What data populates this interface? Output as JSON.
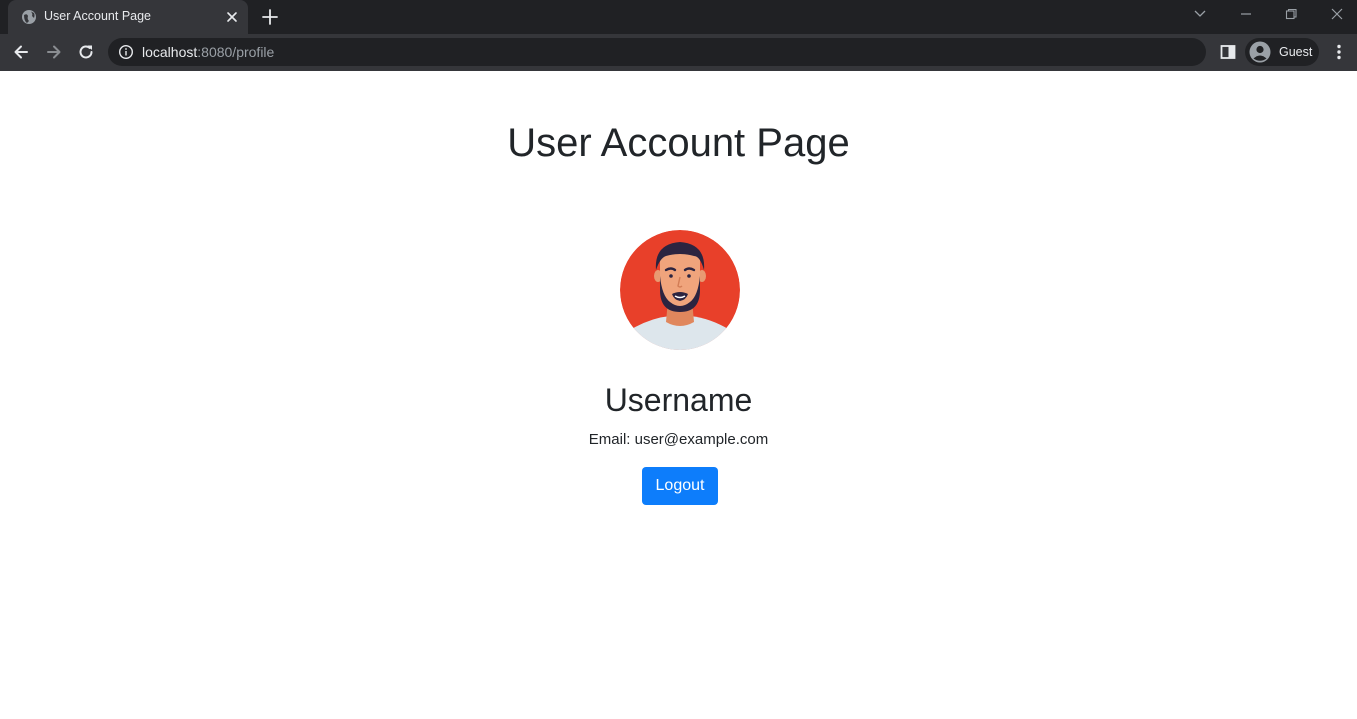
{
  "browser": {
    "tab": {
      "title": "User Account Page",
      "favicon": "globe-icon"
    },
    "address_bar": {
      "host": "localhost",
      "rest": ":8080/profile"
    },
    "profile": {
      "label": "Guest"
    }
  },
  "page": {
    "title": "User Account Page",
    "avatar": "avatar-illustration",
    "username": "Username",
    "email": "Email: user@example.com",
    "logout_label": "Logout"
  },
  "colors": {
    "accent": "#0d7dfb",
    "avatar_bg": "#e8402a",
    "chrome_dark": "#202124",
    "chrome_toolbar": "#35363a"
  }
}
